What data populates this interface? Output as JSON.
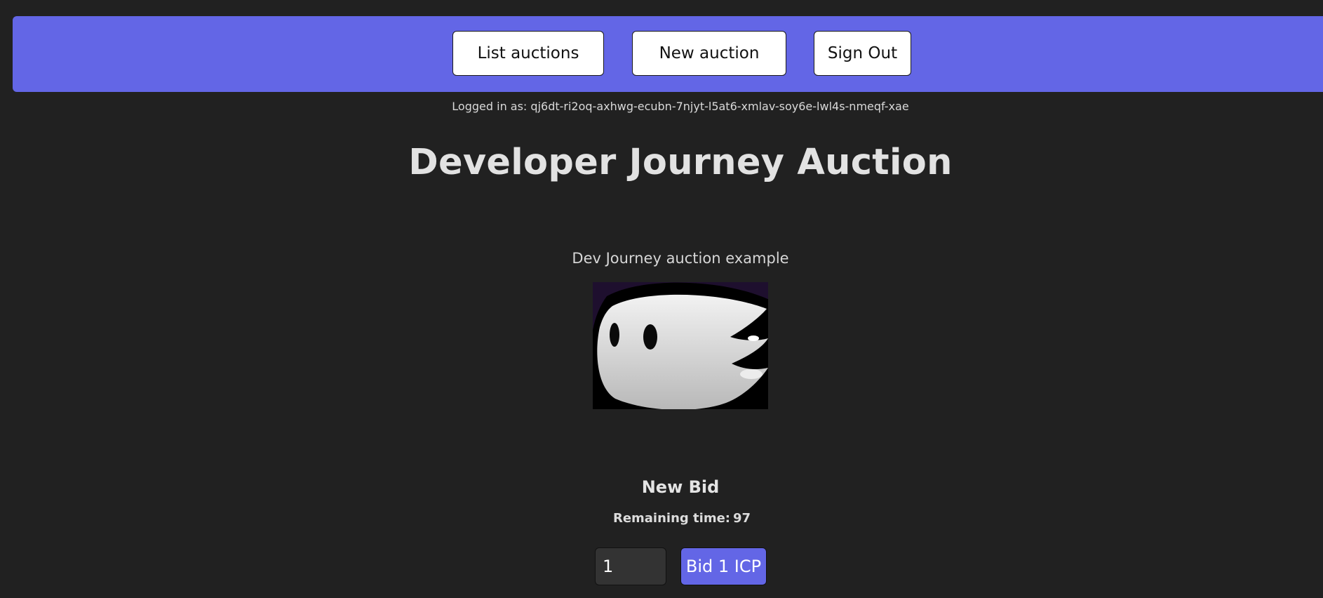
{
  "nav": {
    "list_auctions": "List auctions",
    "new_auction": "New auction",
    "sign_out": "Sign Out"
  },
  "user": {
    "logged_in_text": "Logged in as: qj6dt-ri2oq-axhwg-ecubn-7njyt-l5at6-xmlav-soy6e-lwl4s-nmeqf-xae"
  },
  "auction": {
    "title": "Developer Journey Auction",
    "description": "Dev Journey auction example",
    "image_icon": "ghost-image"
  },
  "bid": {
    "heading": "New Bid",
    "remaining_label": "Remaining time:",
    "remaining_value": "97",
    "input_value": "1",
    "button_label": "Bid 1 ICP"
  },
  "colors": {
    "accent": "#6366e6",
    "background": "#212121",
    "image_background": "#1e0f2e"
  }
}
